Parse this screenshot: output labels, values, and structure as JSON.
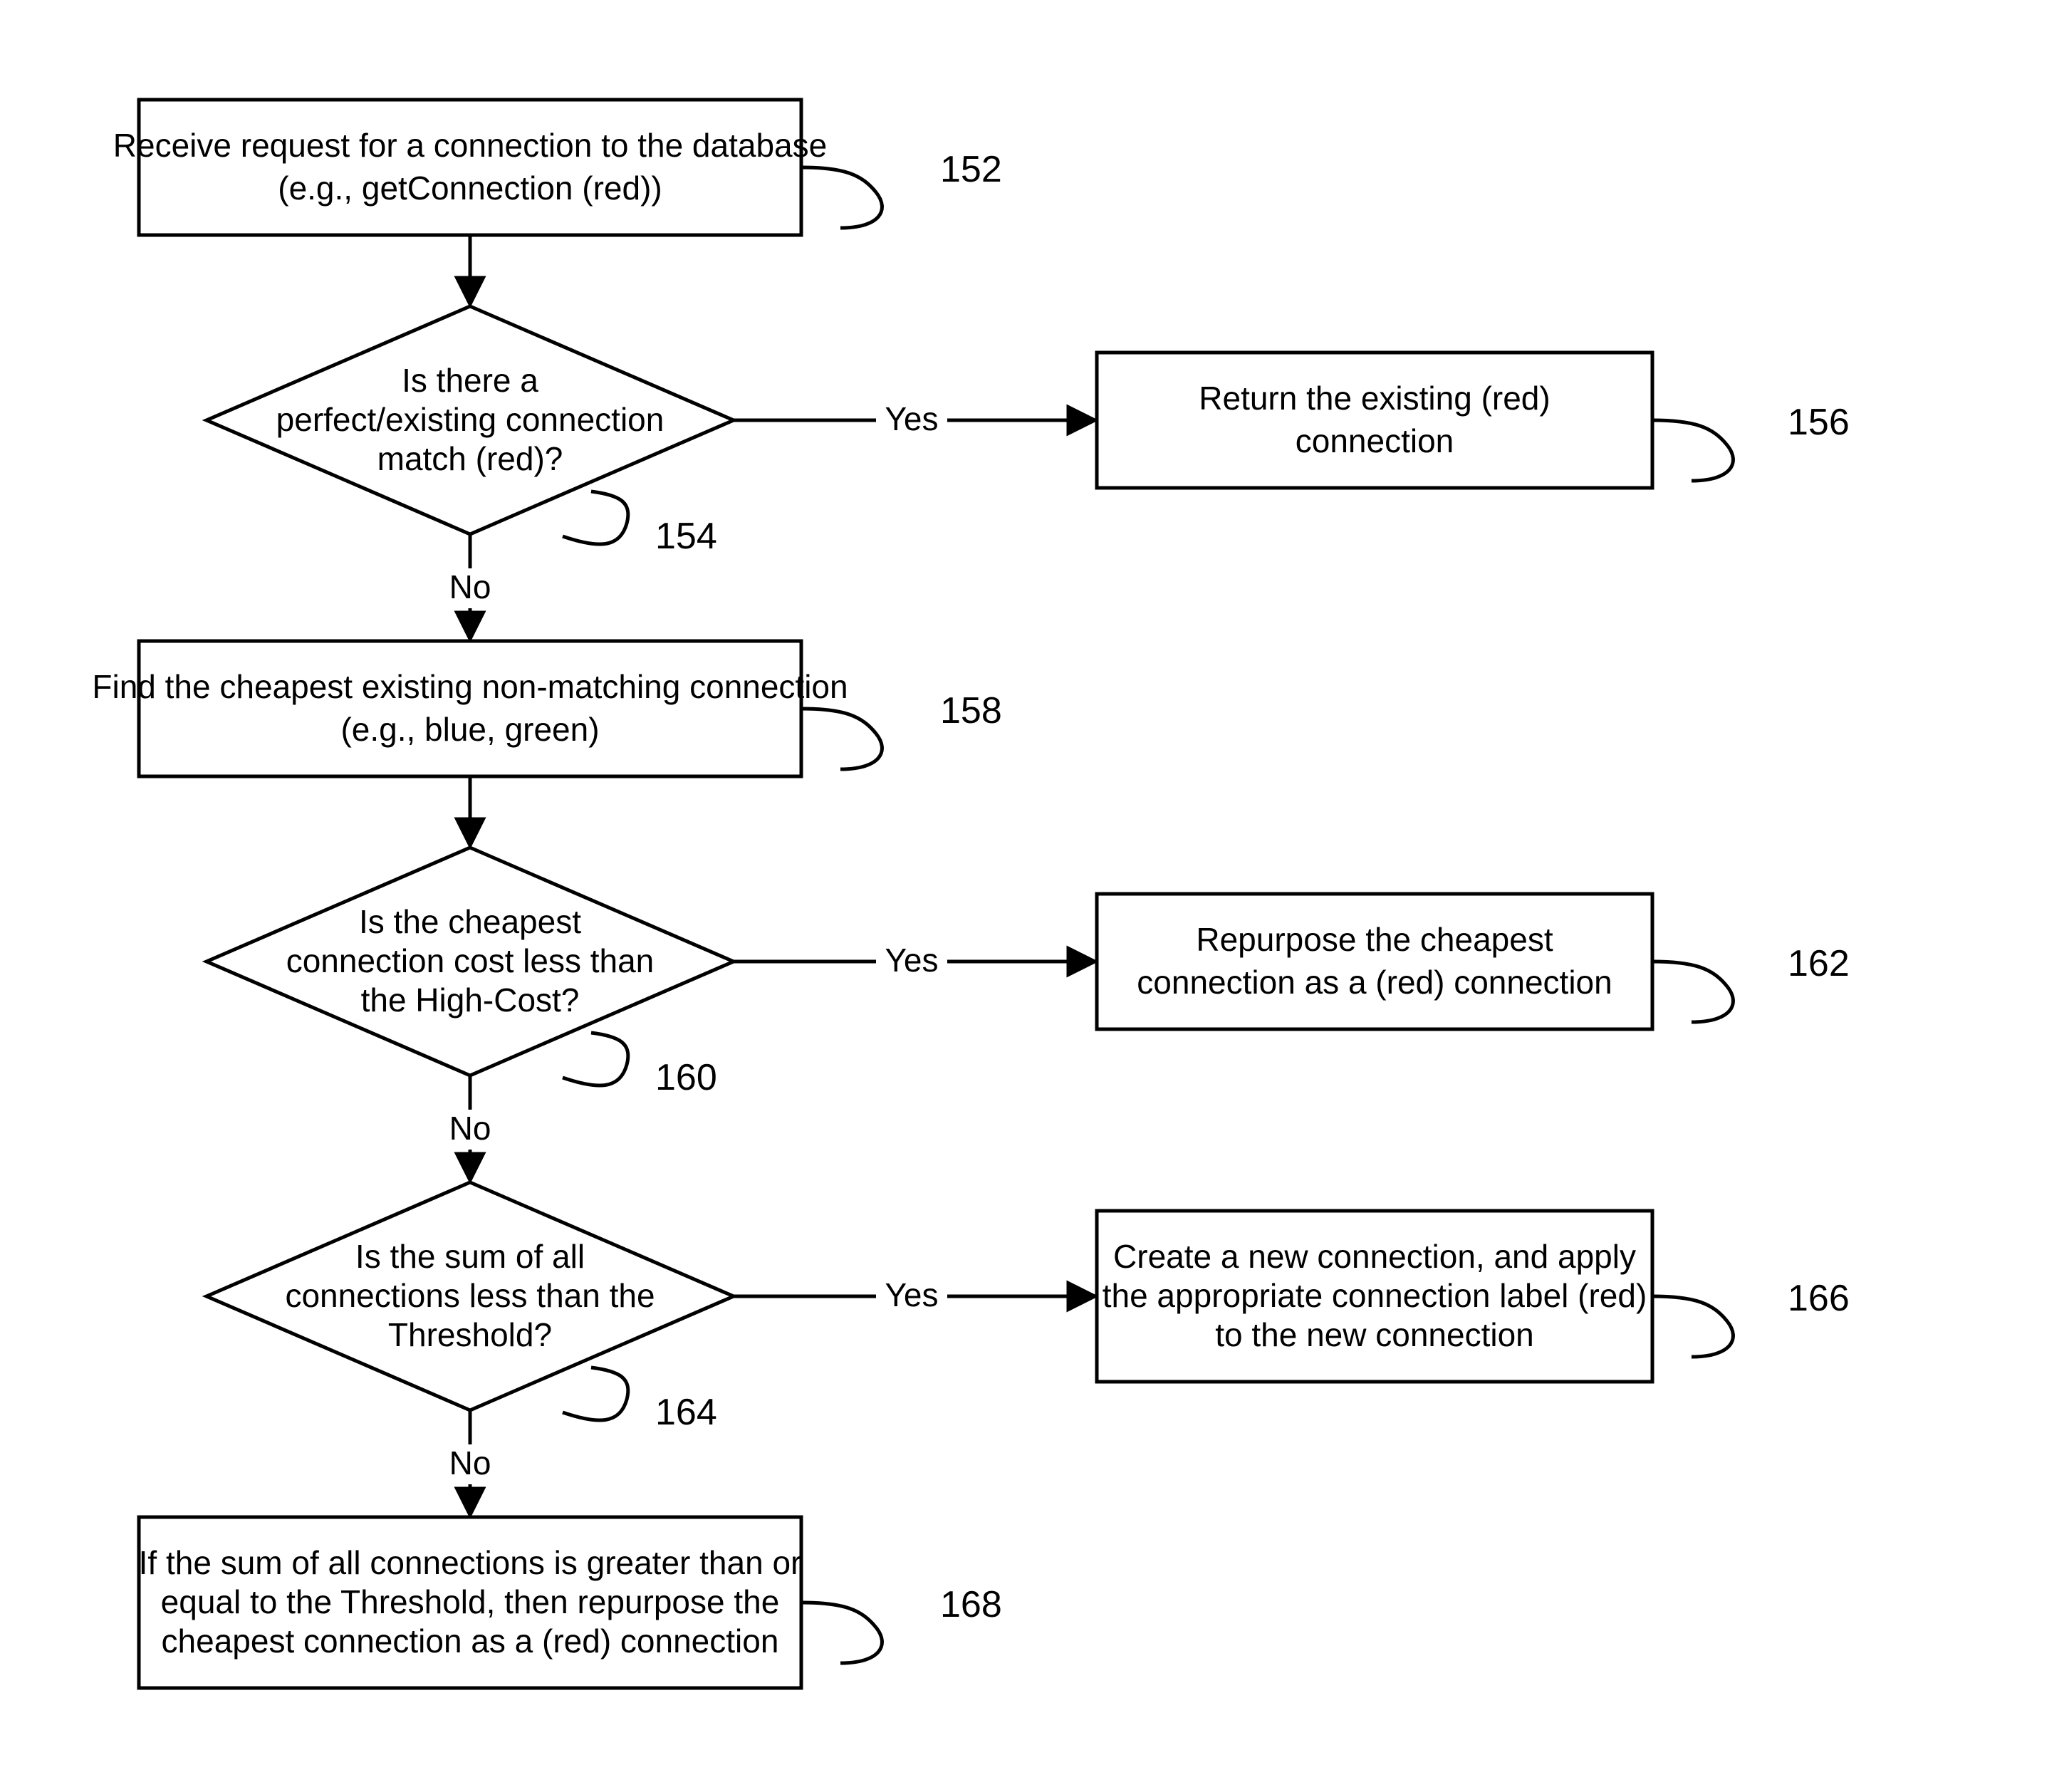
{
  "diagram": {
    "nodes": {
      "n152": {
        "l1": "Receive request for a connection to the database",
        "l2": "(e.g., getConnection (red))"
      },
      "n154": {
        "l1": "Is there a",
        "l2": "perfect/existing  connection",
        "l3": "match (red)?"
      },
      "n156": {
        "l1": "Return the existing (red)",
        "l2": "connection"
      },
      "n158": {
        "l1": "Find the cheapest existing non-matching connection",
        "l2": "(e.g., blue, green)"
      },
      "n160": {
        "l1": "Is the cheapest",
        "l2": "connection cost less than",
        "l3": "the High-Cost?"
      },
      "n162": {
        "l1": "Repurpose the cheapest",
        "l2": "connection as a (red) connection"
      },
      "n164": {
        "l1": "Is the sum of all",
        "l2": "connections less than the",
        "l3": "Threshold?"
      },
      "n166": {
        "l1": "Create a new connection, and apply",
        "l2": "the appropriate connection label (red)",
        "l3": "to the new connection"
      },
      "n168": {
        "l1": "If the sum of all connections is greater than or",
        "l2": "equal to the Threshold, then repurpose the",
        "l3": "cheapest connection as a (red) connection"
      }
    },
    "edgeLabels": {
      "yes": "Yes",
      "no": "No"
    },
    "refs": {
      "r152": "152",
      "r154": "154",
      "r156": "156",
      "r158": "158",
      "r160": "160",
      "r162": "162",
      "r164": "164",
      "r166": "166",
      "r168": "168"
    }
  }
}
